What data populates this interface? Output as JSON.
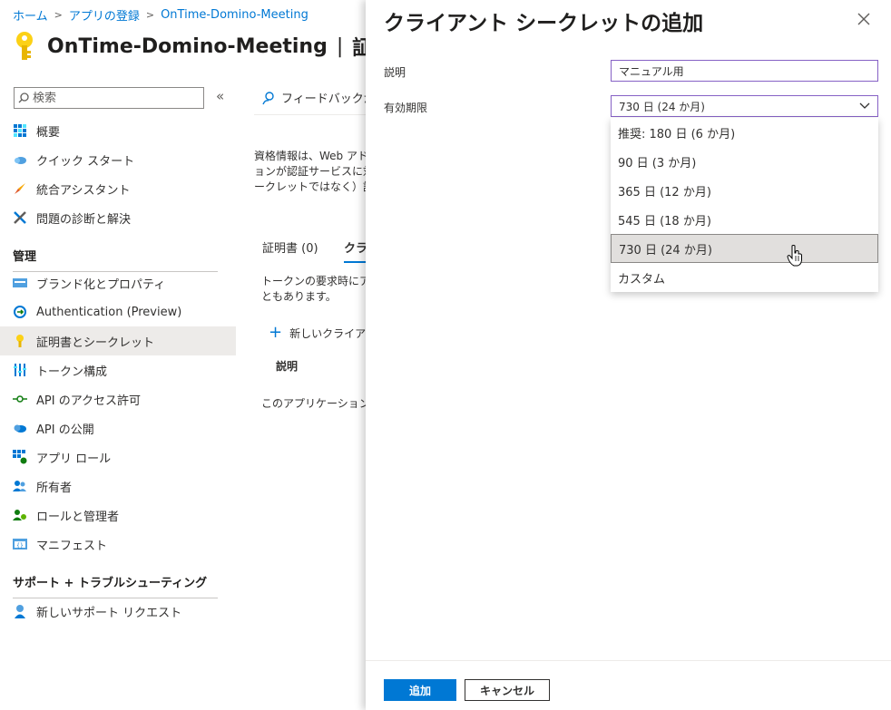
{
  "breadcrumb": {
    "home": "ホーム",
    "registrations": "アプリの登録",
    "app": "OnTime-Domino-Meeting"
  },
  "header": {
    "title": "OnTime-Domino-Meeting",
    "suffix": "証明"
  },
  "search": {
    "placeholder": "検索"
  },
  "sidebar": {
    "items_top": [
      {
        "label": "概要",
        "icon": "overview-icon"
      },
      {
        "label": "クイック スタート",
        "icon": "cloud-icon"
      },
      {
        "label": "統合アシスタント",
        "icon": "rocket-icon"
      },
      {
        "label": "問題の診断と解決",
        "icon": "tools-icon"
      }
    ],
    "section_manage": "管理",
    "items_manage": [
      {
        "label": "ブランド化とプロパティ",
        "icon": "branding-icon"
      },
      {
        "label": "Authentication (Preview)",
        "icon": "auth-icon"
      },
      {
        "label": "証明書とシークレット",
        "icon": "key-icon"
      },
      {
        "label": "トークン構成",
        "icon": "token-icon"
      },
      {
        "label": "API のアクセス許可",
        "icon": "api-permission-icon"
      },
      {
        "label": "API の公開",
        "icon": "cloud-api-icon"
      },
      {
        "label": "アプリ ロール",
        "icon": "app-roles-icon"
      },
      {
        "label": "所有者",
        "icon": "owners-icon"
      },
      {
        "label": "ロールと管理者",
        "icon": "admin-icon"
      },
      {
        "label": "マニフェスト",
        "icon": "manifest-icon"
      }
    ],
    "section_support": "サポート + トラブルシューティング",
    "items_support": [
      {
        "label": "新しいサポート リクエスト",
        "icon": "support-icon"
      }
    ]
  },
  "main": {
    "feedback": "フィードバックがある",
    "desc_line1": "資格情報は、Web アド",
    "desc_line2": "ョンが認証サービスに対し",
    "desc_line3": "ークレットではなく）証明",
    "tab_certs": "証明書 (0)",
    "tab_secrets": "クライ",
    "token_line1": "トークンの要求時にアプ",
    "token_line2": "ともあります。",
    "new_secret": "新しいクライアント",
    "col_desc": "説明",
    "empty": "このアプリケーションのク"
  },
  "panel": {
    "title": "クライアント シークレットの追加",
    "desc_label": "説明",
    "desc_value": "マニュアル用",
    "expiry_label": "有効期限",
    "expiry_value": "730 日 (24 か月)",
    "options": [
      "推奨: 180 日 (6 か月)",
      "90 日 (3 か月)",
      "365 日 (12 か月)",
      "545 日 (18 か月)",
      "730 日 (24 か月)",
      "カスタム"
    ],
    "add_button": "追加",
    "cancel_button": "キャンセル"
  },
  "colors": {
    "accent": "#0078d4",
    "focus_border": "#8661c5",
    "selected_bg": "#e1dfdd"
  }
}
